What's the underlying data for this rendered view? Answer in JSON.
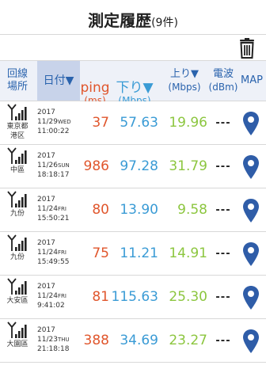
{
  "header": {
    "title": "測定履歴",
    "count": "(9件)"
  },
  "columns": {
    "location": [
      "回線",
      "場所"
    ],
    "date": "日付▼",
    "ping": [
      "ping",
      "(ms)"
    ],
    "download": [
      "下り▼",
      "(Mbps)"
    ],
    "upload": [
      "上り▼",
      "(Mbps)"
    ],
    "signal": [
      "電波",
      "(dBm)"
    ],
    "map": "MAP"
  },
  "icons": {
    "antenna": "antenna-signal-icon",
    "pin": "map-pin-icon",
    "trash": "trash-icon"
  },
  "colors": {
    "ping": "#e0562c",
    "download": "#3a9bd5",
    "upload": "#8cc63f",
    "header_text": "#2a63ad",
    "pin": "#2f5da8"
  },
  "rows": [
    {
      "area": [
        "東京都",
        "港区"
      ],
      "year": "2017",
      "date": "11/29",
      "weekday": "WED",
      "time": "11:00:22",
      "ping": "37",
      "download": "57.63",
      "upload": "19.96",
      "signal": "---"
    },
    {
      "area": [
        "中區"
      ],
      "year": "2017",
      "date": "11/26",
      "weekday": "SUN",
      "time": "18:18:17",
      "ping": "986",
      "download": "97.28",
      "upload": "31.79",
      "signal": "---"
    },
    {
      "area": [
        "九份"
      ],
      "year": "2017",
      "date": "11/24",
      "weekday": "FRI",
      "time": "15:50:21",
      "ping": "80",
      "download": "13.90",
      "upload": "9.58",
      "signal": "---"
    },
    {
      "area": [
        "九份"
      ],
      "year": "2017",
      "date": "11/24",
      "weekday": "FRI",
      "time": "15:49:55",
      "ping": "75",
      "download": "11.21",
      "upload": "14.91",
      "signal": "---"
    },
    {
      "area": [
        "大安區"
      ],
      "year": "2017",
      "date": "11/24",
      "weekday": "FRI",
      "time": "9:41:02",
      "ping": "81",
      "download": "115.63",
      "upload": "25.30",
      "signal": "---"
    },
    {
      "area": [
        "大園區"
      ],
      "year": "2017",
      "date": "11/23",
      "weekday": "THU",
      "time": "21:18:18",
      "ping": "388",
      "download": "34.69",
      "upload": "23.27",
      "signal": "---"
    }
  ]
}
